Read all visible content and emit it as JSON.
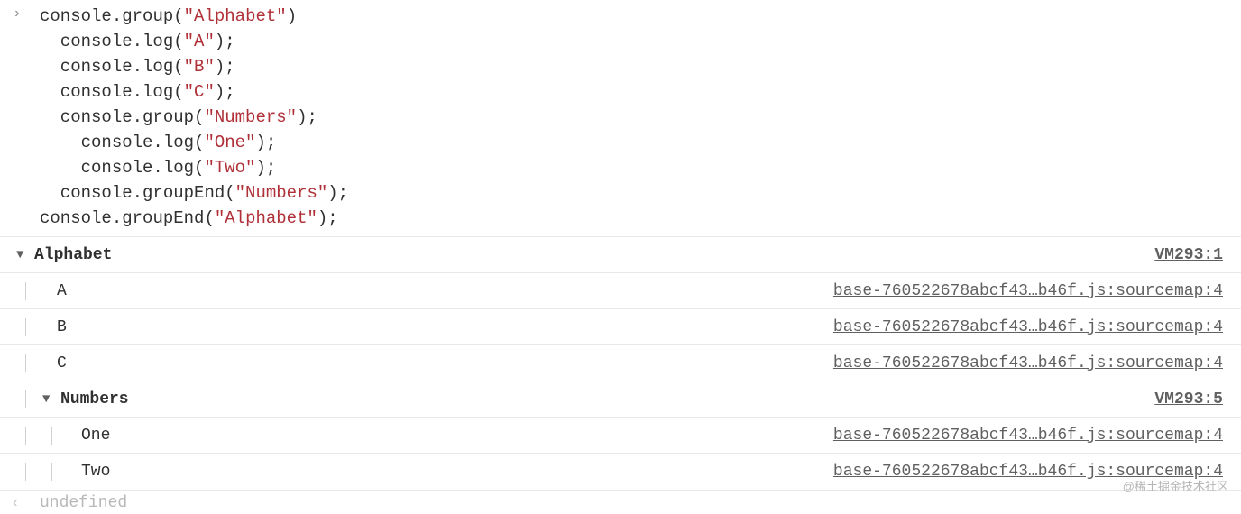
{
  "input": {
    "prompt": "›",
    "lines": [
      [
        {
          "t": "console",
          "c": "tok-default"
        },
        {
          "t": ".",
          "c": "tok-punct"
        },
        {
          "t": "group",
          "c": "tok-default"
        },
        {
          "t": "(",
          "c": "tok-punct"
        },
        {
          "t": "\"Alphabet\"",
          "c": "tok-string"
        },
        {
          "t": ")",
          "c": "tok-punct"
        }
      ],
      [
        {
          "t": "  console",
          "c": "tok-default"
        },
        {
          "t": ".",
          "c": "tok-punct"
        },
        {
          "t": "log",
          "c": "tok-default"
        },
        {
          "t": "(",
          "c": "tok-punct"
        },
        {
          "t": "\"A\"",
          "c": "tok-string"
        },
        {
          "t": ");",
          "c": "tok-punct"
        }
      ],
      [
        {
          "t": "  console",
          "c": "tok-default"
        },
        {
          "t": ".",
          "c": "tok-punct"
        },
        {
          "t": "log",
          "c": "tok-default"
        },
        {
          "t": "(",
          "c": "tok-punct"
        },
        {
          "t": "\"B\"",
          "c": "tok-string"
        },
        {
          "t": ");",
          "c": "tok-punct"
        }
      ],
      [
        {
          "t": "  console",
          "c": "tok-default"
        },
        {
          "t": ".",
          "c": "tok-punct"
        },
        {
          "t": "log",
          "c": "tok-default"
        },
        {
          "t": "(",
          "c": "tok-punct"
        },
        {
          "t": "\"C\"",
          "c": "tok-string"
        },
        {
          "t": ");",
          "c": "tok-punct"
        }
      ],
      [
        {
          "t": "  console",
          "c": "tok-default"
        },
        {
          "t": ".",
          "c": "tok-punct"
        },
        {
          "t": "group",
          "c": "tok-default"
        },
        {
          "t": "(",
          "c": "tok-punct"
        },
        {
          "t": "\"Numbers\"",
          "c": "tok-string"
        },
        {
          "t": ");",
          "c": "tok-punct"
        }
      ],
      [
        {
          "t": "    console",
          "c": "tok-default"
        },
        {
          "t": ".",
          "c": "tok-punct"
        },
        {
          "t": "log",
          "c": "tok-default"
        },
        {
          "t": "(",
          "c": "tok-punct"
        },
        {
          "t": "\"One\"",
          "c": "tok-string"
        },
        {
          "t": ");",
          "c": "tok-punct"
        }
      ],
      [
        {
          "t": "    console",
          "c": "tok-default"
        },
        {
          "t": ".",
          "c": "tok-punct"
        },
        {
          "t": "log",
          "c": "tok-default"
        },
        {
          "t": "(",
          "c": "tok-punct"
        },
        {
          "t": "\"Two\"",
          "c": "tok-string"
        },
        {
          "t": ");",
          "c": "tok-punct"
        }
      ],
      [
        {
          "t": "  console",
          "c": "tok-default"
        },
        {
          "t": ".",
          "c": "tok-punct"
        },
        {
          "t": "groupEnd",
          "c": "tok-default"
        },
        {
          "t": "(",
          "c": "tok-punct"
        },
        {
          "t": "\"Numbers\"",
          "c": "tok-string"
        },
        {
          "t": ");",
          "c": "tok-punct"
        }
      ],
      [
        {
          "t": "console",
          "c": "tok-default"
        },
        {
          "t": ".",
          "c": "tok-punct"
        },
        {
          "t": "groupEnd",
          "c": "tok-default"
        },
        {
          "t": "(",
          "c": "tok-punct"
        },
        {
          "t": "\"Alphabet\"",
          "c": "tok-string"
        },
        {
          "t": ");",
          "c": "tok-punct"
        }
      ]
    ]
  },
  "output": {
    "group1": {
      "label": "Alphabet",
      "source": "VM293:1",
      "items": [
        {
          "text": "A",
          "source": "base-760522678abcf43…b46f.js:sourcemap:4"
        },
        {
          "text": "B",
          "source": "base-760522678abcf43…b46f.js:sourcemap:4"
        },
        {
          "text": "C",
          "source": "base-760522678abcf43…b46f.js:sourcemap:4"
        }
      ],
      "group2": {
        "label": "Numbers",
        "source": "VM293:5",
        "items": [
          {
            "text": "One",
            "source": "base-760522678abcf43…b46f.js:sourcemap:4"
          },
          {
            "text": "Two",
            "source": "base-760522678abcf43…b46f.js:sourcemap:4"
          }
        ]
      }
    }
  },
  "return": {
    "prompt": "‹",
    "value": "undefined"
  },
  "disclose_glyph": "▼",
  "watermark": "@稀土掘金技术社区"
}
